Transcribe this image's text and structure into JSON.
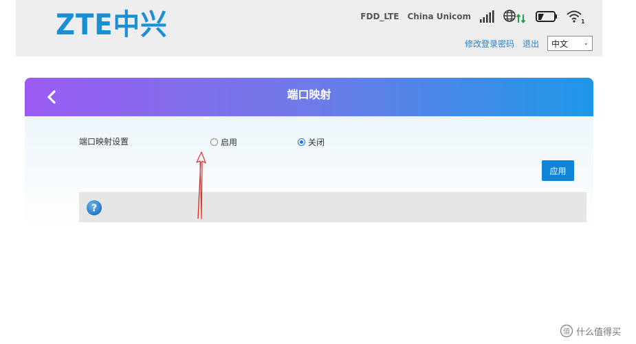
{
  "header": {
    "logo": "ZTE中兴",
    "network_type": "FDD_LTE",
    "carrier": "China Unicom",
    "icons": [
      "signal-icon",
      "globe-data-icon",
      "battery-icon",
      "wifi-icon"
    ],
    "wifi_count": "1",
    "links": {
      "change_password": "修改登录密码",
      "logout": "退出"
    },
    "language": "中文"
  },
  "panel": {
    "title": "端口映射",
    "setting_label": "端口映射设置",
    "options": [
      {
        "label": "启用",
        "checked": false
      },
      {
        "label": "关闭",
        "checked": true
      }
    ],
    "apply_label": "应用",
    "help_icon_char": "?"
  },
  "watermark": {
    "text": "什么值得买",
    "icon": "值"
  },
  "colors": {
    "brand": "#1a8fd6",
    "link": "#2a7fc8",
    "apply_button": "#1184d8",
    "annotation": "#d9312a"
  }
}
